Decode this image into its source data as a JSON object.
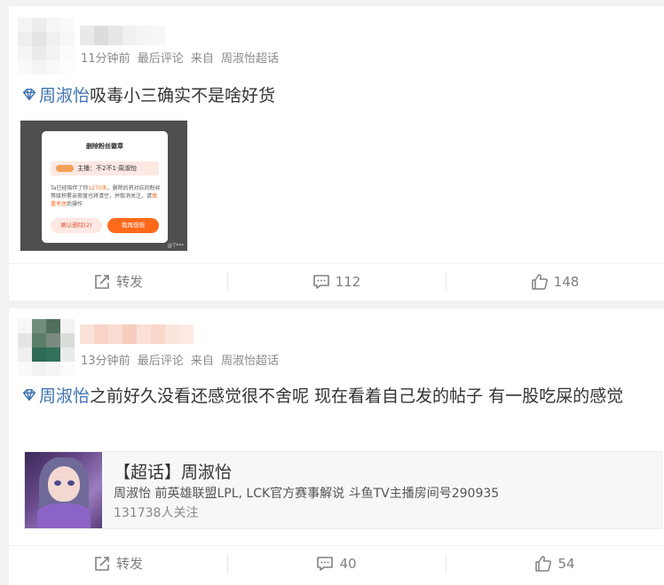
{
  "posts": [
    {
      "meta": {
        "time": "11分钟前",
        "kind": "最后评论",
        "source": "来自",
        "topic_source": "周淑怡超话"
      },
      "tag": "周淑怡",
      "text": "吸毒小三确实不是啥好货",
      "attachment": {
        "title": "删除粉丝徽章",
        "badge_label": "主播：不2不1·周淑怡",
        "body_prefix": "Ta已经陪伴了你",
        "body_days": "1270天",
        "body_rest": "，删除后将对应的粉丝等级积累亲密度也将清空，并取消关注，请",
        "body_warn": "慎重考虑",
        "body_tail": "后操作",
        "confirm_label": "确认删除(2)",
        "keep_label": "我再想想",
        "watermark": "@T*** "
      },
      "actions": {
        "repost": "转发",
        "comments": "112",
        "likes": "148"
      }
    },
    {
      "meta": {
        "time": "13分钟前",
        "kind": "最后评论",
        "source": "来自",
        "topic_source": "周淑怡超话"
      },
      "tag": "周淑怡",
      "text": "之前好久没看还感觉很不舍呢 现在看着自己发的帖子 有一股吃屎的感觉",
      "topic_card": {
        "title": "【超话】周淑怡",
        "desc": "周淑怡 前英雄联盟LPL, LCK官方赛事解说 斗鱼TV主播房间号290935",
        "followers": "131738人关注"
      },
      "actions": {
        "repost": "转发",
        "comments": "40",
        "likes": "54"
      }
    }
  ],
  "colors": {
    "tag": "#3f72b2",
    "meta": "#8a8a8a",
    "accent_orange": "#ff6a1a"
  },
  "icons": {
    "tag": "diamond-icon",
    "repost": "share-icon",
    "comment": "comment-icon",
    "like": "thumb-up-icon"
  }
}
